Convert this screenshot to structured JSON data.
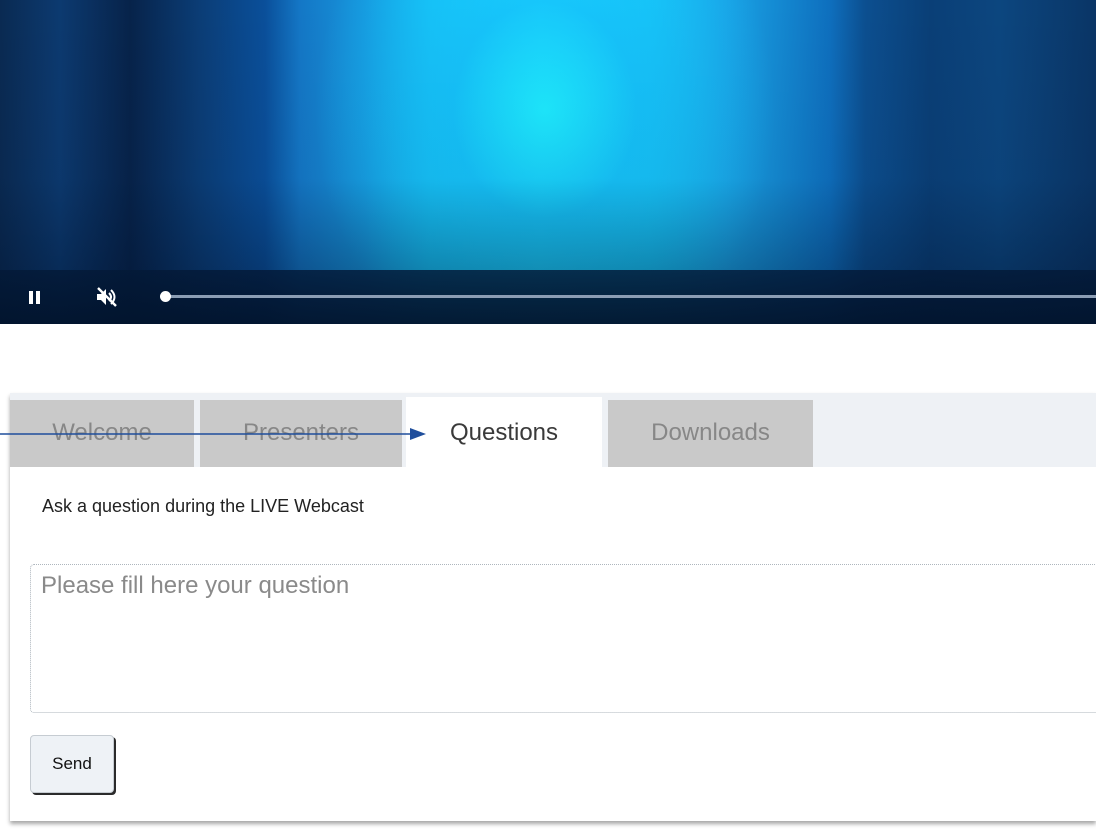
{
  "player": {
    "pause_icon": "pause-icon",
    "mute_icon": "muted-speaker-icon",
    "progress": 0
  },
  "tabs": [
    {
      "label": "Welcome",
      "active": false
    },
    {
      "label": "Presenters",
      "active": false
    },
    {
      "label": "Questions",
      "active": true
    },
    {
      "label": "Downloads",
      "active": false
    }
  ],
  "questions": {
    "prompt": "Ask a question during the LIVE Webcast",
    "placeholder": "Please fill here your question",
    "value": "",
    "send_label": "Send"
  },
  "annotation": {
    "color": "#1f4e9c"
  }
}
